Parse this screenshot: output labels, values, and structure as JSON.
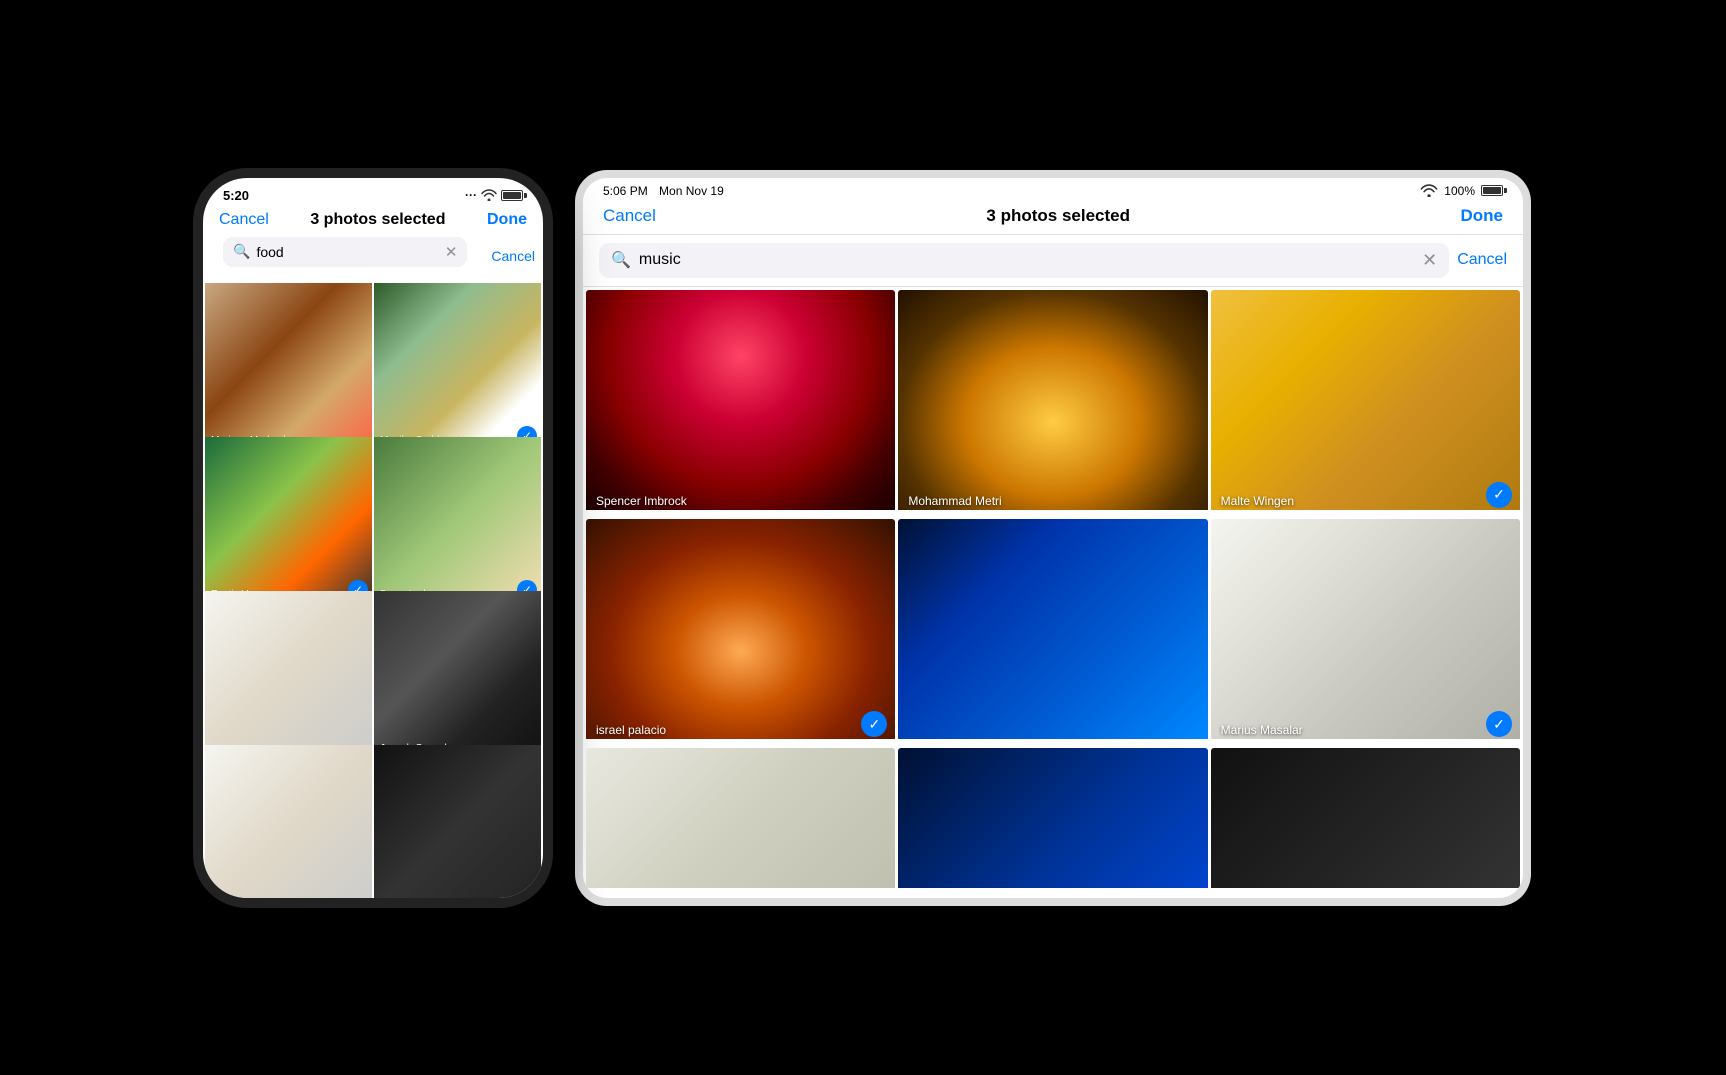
{
  "phone": {
    "status": {
      "time": "5:20",
      "battery_percent": 100
    },
    "header": {
      "cancel_label": "Cancel",
      "title": "3 photos selected",
      "done_label": "Done"
    },
    "search": {
      "value": "food",
      "cancel_label": "Cancel"
    },
    "grid": [
      {
        "label": "Mariana Medvedeva",
        "selected": false,
        "img_class": "img-food-1"
      },
      {
        "label": "Monika Grabkowska",
        "selected": true,
        "img_class": "img-food-2"
      },
      {
        "label": "Rustic Vegan",
        "selected": true,
        "img_class": "img-food-3"
      },
      {
        "label": "Broca Lark",
        "selected": true,
        "img_class": "img-food-4"
      },
      {
        "label": "",
        "selected": false,
        "img_class": "img-food-7"
      },
      {
        "label": "Joseph Gonzalez",
        "selected": false,
        "img_class": "img-food-6"
      },
      {
        "label": "",
        "selected": false,
        "img_class": "img-food-7"
      },
      {
        "label": "",
        "selected": false,
        "img_class": "img-food-8"
      }
    ]
  },
  "tablet": {
    "status": {
      "time": "5:06 PM",
      "date": "Mon Nov 19",
      "battery_percent": "100%"
    },
    "header": {
      "cancel_label": "Cancel",
      "title": "3 photos selected",
      "done_label": "Done"
    },
    "search": {
      "value": "music",
      "cancel_label": "Cancel"
    },
    "grid": [
      {
        "label": "Spencer Imbrock",
        "selected": false,
        "img_class": "img-music-1",
        "row": 1
      },
      {
        "label": "Mohammad Metri",
        "selected": false,
        "img_class": "img-music-2",
        "row": 1
      },
      {
        "label": "Malte Wingen",
        "selected": true,
        "img_class": "img-music-3",
        "row": 1
      },
      {
        "label": "israel palacio",
        "selected": true,
        "img_class": "img-music-4",
        "row": 2
      },
      {
        "label": "",
        "selected": false,
        "img_class": "img-music-5",
        "row": 2
      },
      {
        "label": "Marius Masalar",
        "selected": true,
        "img_class": "img-music-6",
        "row": 2
      },
      {
        "label": "",
        "selected": false,
        "img_class": "img-music-7",
        "row": 3
      },
      {
        "label": "",
        "selected": false,
        "img_class": "img-music-8",
        "row": 3
      },
      {
        "label": "",
        "selected": false,
        "img_class": "img-music-9",
        "row": 3
      }
    ]
  },
  "icons": {
    "search": "🔍",
    "check": "✓",
    "clear": "✕"
  }
}
